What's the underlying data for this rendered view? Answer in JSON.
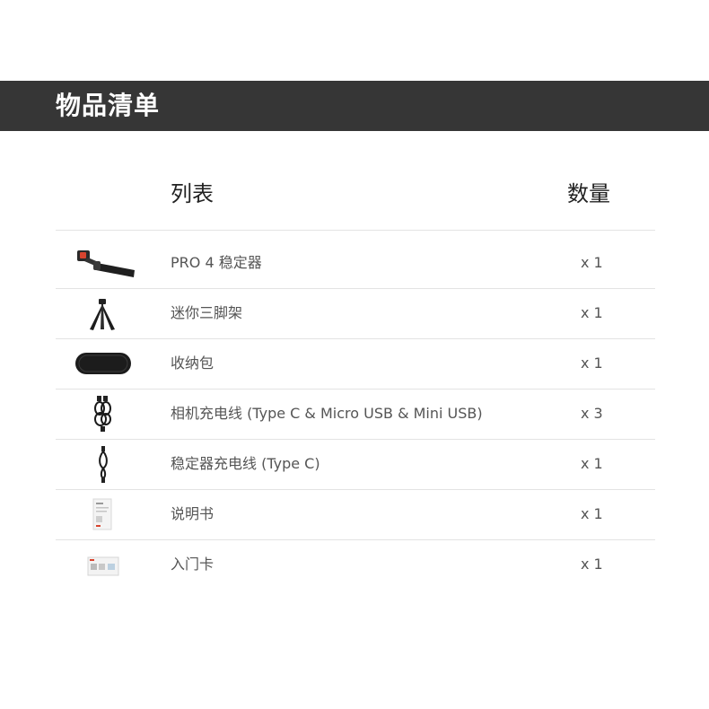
{
  "banner": {
    "title": "物品清单"
  },
  "table": {
    "header": {
      "name": "列表",
      "quantity": "数量"
    },
    "rows": [
      {
        "icon": "gimbal-icon",
        "name": "PRO 4 稳定器",
        "quantity": "x 1"
      },
      {
        "icon": "tripod-icon",
        "name": "迷你三脚架",
        "quantity": "x 1"
      },
      {
        "icon": "case-icon",
        "name": "收纳包",
        "quantity": "x 1"
      },
      {
        "icon": "cables-icon",
        "name": "相机充电线 (Type C & Micro USB & Mini USB)",
        "quantity": "x 3"
      },
      {
        "icon": "cable-icon",
        "name": "稳定器充电线 (Type C)",
        "quantity": "x 1"
      },
      {
        "icon": "manual-icon",
        "name": "说明书",
        "quantity": "x 1"
      },
      {
        "icon": "card-icon",
        "name": "入门卡",
        "quantity": "x 1"
      }
    ]
  },
  "colors": {
    "banner": "#363636",
    "divider": "#e3e3e3",
    "text": "#555555"
  }
}
